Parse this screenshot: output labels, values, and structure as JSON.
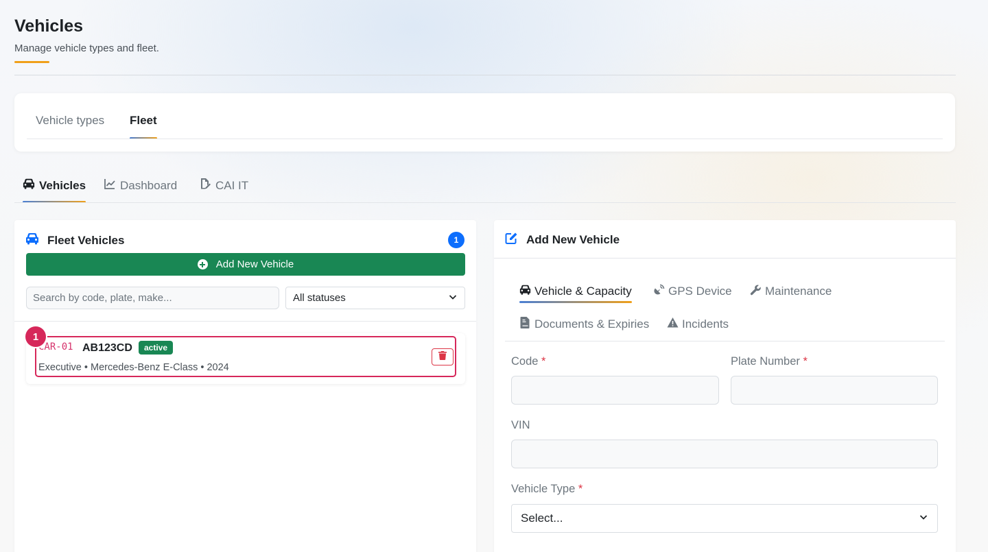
{
  "header": {
    "title": "Vehicles",
    "subtitle": "Manage vehicle types and fleet."
  },
  "top_tabs": [
    {
      "label": "Vehicle types",
      "active": false
    },
    {
      "label": "Fleet",
      "active": true
    }
  ],
  "sub_tabs": [
    {
      "label": "Vehicles",
      "icon": "car-icon",
      "active": true
    },
    {
      "label": "Dashboard",
      "icon": "chart-line-icon",
      "active": false
    },
    {
      "label": "CAI IT",
      "icon": "file-signature-icon",
      "active": false
    }
  ],
  "fleet_panel": {
    "title": "Fleet Vehicles",
    "count": "1",
    "add_button": "Add New Vehicle",
    "search_placeholder": "Search by code, plate, make...",
    "status_filter": "All statuses",
    "vehicles": [
      {
        "code": "CAR-01",
        "plate": "AB123CD",
        "status": "active",
        "meta": "Executive • Mercedes-Benz E-Class • 2024"
      }
    ],
    "marker": "1"
  },
  "form_panel": {
    "title": "Add New Vehicle",
    "tabs": [
      {
        "label": "Vehicle & Capacity",
        "icon": "car-icon",
        "active": true
      },
      {
        "label": "GPS Device",
        "icon": "satellite-dish-icon",
        "active": false
      },
      {
        "label": "Maintenance",
        "icon": "wrench-icon",
        "active": false
      },
      {
        "label": "Documents & Expiries",
        "icon": "file-contract-icon",
        "active": false
      },
      {
        "label": "Incidents",
        "icon": "warning-icon",
        "active": false
      }
    ],
    "fields": {
      "code": {
        "label": "Code",
        "required": "*",
        "value": ""
      },
      "plate": {
        "label": "Plate Number",
        "required": "*",
        "value": ""
      },
      "vin": {
        "label": "VIN",
        "value": ""
      },
      "vehicle_type": {
        "label": "Vehicle Type",
        "required": "*",
        "value": "Select..."
      }
    }
  },
  "colors": {
    "primary": "#0d6efd",
    "success": "#198754",
    "danger": "#dc3545",
    "highlight": "#d6275a",
    "accent": "#f0a01a"
  }
}
